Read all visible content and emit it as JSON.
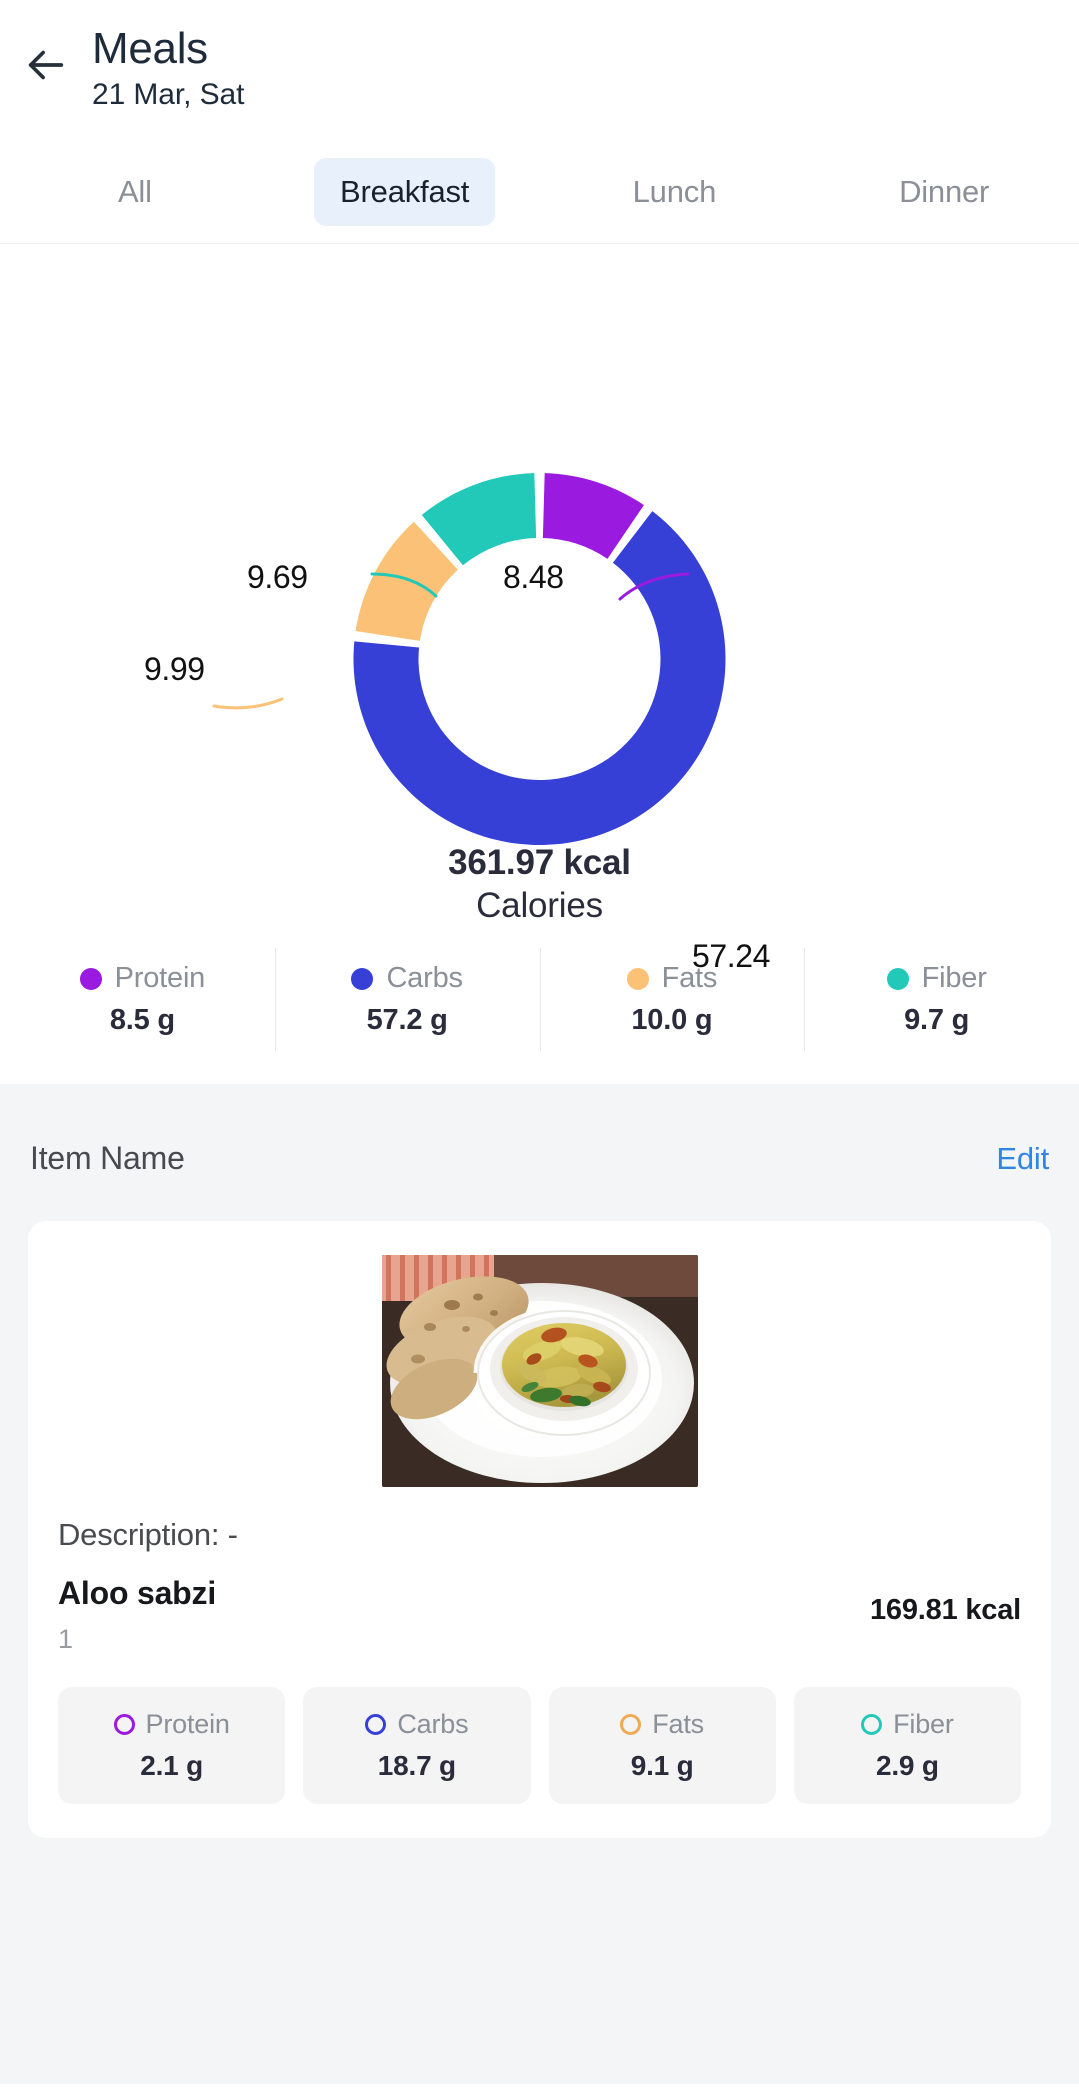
{
  "header": {
    "back_icon": "arrow-left-icon",
    "title": "Meals",
    "subtitle": "21 Mar, Sat"
  },
  "tabs": [
    {
      "label": "All",
      "active": false
    },
    {
      "label": "Breakfast",
      "active": true
    },
    {
      "label": "Lunch",
      "active": false
    },
    {
      "label": "Dinner",
      "active": false
    }
  ],
  "chart_data": {
    "type": "pie",
    "title": "361.97 kcal Calories",
    "center_value": "361.97 kcal",
    "center_label": "Calories",
    "categories": [
      "Protein",
      "Carbs",
      "Fats",
      "Fiber"
    ],
    "values": [
      8.48,
      57.24,
      9.99,
      9.69
    ],
    "value_labels": [
      "8.48",
      "57.24",
      "9.99",
      "9.69"
    ],
    "colors": [
      "#9a1ae0",
      "#3640d6",
      "#fbc176",
      "#22c8b8"
    ],
    "legend_position": "bottom",
    "donut": true,
    "start_angle_deg": 0,
    "direction": "clockwise",
    "grid": false
  },
  "legend": [
    {
      "name": "Protein",
      "value": "8.5 g",
      "color": "#9a1ae0"
    },
    {
      "name": "Carbs",
      "value": "57.2 g",
      "color": "#3640d6"
    },
    {
      "name": "Fats",
      "value": "10.0 g",
      "color": "#fbc176"
    },
    {
      "name": "Fiber",
      "value": "9.7 g",
      "color": "#22c8b8"
    }
  ],
  "item_section": {
    "heading": "Item Name",
    "edit_label": "Edit",
    "food": {
      "photo_alt": "food-photo",
      "description": "Description: -",
      "name": "Aloo sabzi",
      "quantity": "1",
      "calories": "169.81 kcal",
      "macros": [
        {
          "name": "Protein",
          "value": "2.1 g",
          "color": "#9a1ae0"
        },
        {
          "name": "Carbs",
          "value": "18.7 g",
          "color": "#3640d6"
        },
        {
          "name": "Fats",
          "value": "9.1 g",
          "color": "#f0a955"
        },
        {
          "name": "Fiber",
          "value": "2.9 g",
          "color": "#22c8b8"
        }
      ]
    }
  }
}
